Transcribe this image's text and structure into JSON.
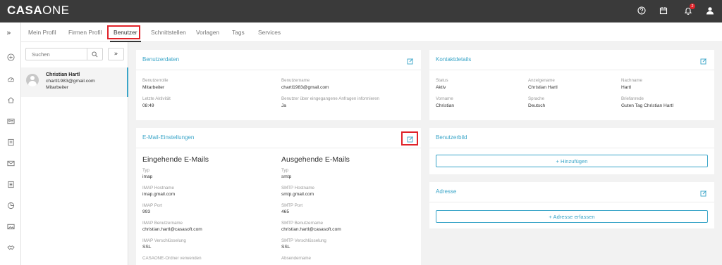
{
  "app": {
    "logo_bold": "CASA",
    "logo_light": "ONE"
  },
  "topbar": {
    "icons": [
      "help-icon",
      "calendar-icon",
      "bell-icon",
      "user-icon"
    ],
    "notification_count": "2"
  },
  "tabs": [
    {
      "label": "Mein Profil"
    },
    {
      "label": "Firmen Profil"
    },
    {
      "label": "Benutzer"
    },
    {
      "label": "Schnittstellen"
    },
    {
      "label": "Vorlagen"
    },
    {
      "label": "Tags"
    },
    {
      "label": "Services"
    }
  ],
  "rail": {
    "expand": "»",
    "icons": [
      "plus-circle-icon",
      "dashboard-icon",
      "home-icon",
      "contacts-icon",
      "document-icon",
      "mail-icon",
      "list-icon",
      "pie-chart-icon",
      "gallery-icon",
      "handshake-icon"
    ]
  },
  "userlist": {
    "search_placeholder": "Suchen",
    "expand": "»",
    "user": {
      "name": "Christian Hartl",
      "email": "chartl1983@gmail.com",
      "role": "Mitarbeiter"
    }
  },
  "benutzerdaten": {
    "title": "Benutzerdaten",
    "fields": [
      {
        "label": "Benutzerrolle",
        "value": "Mitarbeiter"
      },
      {
        "label": "Benutzername",
        "value": "chartl1983@gmail.com"
      },
      {
        "label": "Letzte Aktivität",
        "value": "08:49"
      },
      {
        "label": "Benutzer über eingegangene Anfragen informieren",
        "value": "Ja"
      }
    ]
  },
  "email": {
    "title": "E-Mail-Einstellungen",
    "incoming": {
      "heading": "Eingehende E-Mails",
      "fields": [
        {
          "label": "Typ",
          "value": "imap"
        },
        {
          "label": "IMAP Hostname",
          "value": "imap.gmail.com"
        },
        {
          "label": "IMAP Port",
          "value": "993"
        },
        {
          "label": "IMAP Benutzername",
          "value": "christian.hartl@casasoft.com"
        },
        {
          "label": "IMAP Verschlüsselung",
          "value": "SSL"
        },
        {
          "label": "CASAONE-Ordner verwenden",
          "value": ""
        }
      ]
    },
    "outgoing": {
      "heading": "Ausgehende E-Mails",
      "fields": [
        {
          "label": "Typ",
          "value": "smtp"
        },
        {
          "label": "SMTP Hostname",
          "value": "smtp.gmail.com"
        },
        {
          "label": "SMTP Port",
          "value": "465"
        },
        {
          "label": "SMTP Benutzername",
          "value": "christian.hartl@casasoft.com"
        },
        {
          "label": "SMTP Verschlüsselung",
          "value": "SSL"
        },
        {
          "label": "Absendername",
          "value": ""
        }
      ]
    }
  },
  "kontakt": {
    "title": "Kontaktdetails",
    "fields": [
      {
        "label": "Status",
        "value": "Aktiv"
      },
      {
        "label": "Anzeigename",
        "value": "Christian Hartl"
      },
      {
        "label": "Nachname",
        "value": "Hartl"
      },
      {
        "label": "Vorname",
        "value": "Christian"
      },
      {
        "label": "Sprache",
        "value": "Deutsch"
      },
      {
        "label": "Briefanrede",
        "value": "Guten Tag Christian Hartl"
      }
    ]
  },
  "benutzerbild": {
    "title": "Benutzerbild",
    "button": "+ Hinzufügen"
  },
  "adresse": {
    "title": "Adresse",
    "button": "+ Adresse erfassen"
  },
  "colors": {
    "accent": "#3aa5c8",
    "highlight": "#e0232a",
    "topbar": "#3a3a3a"
  }
}
